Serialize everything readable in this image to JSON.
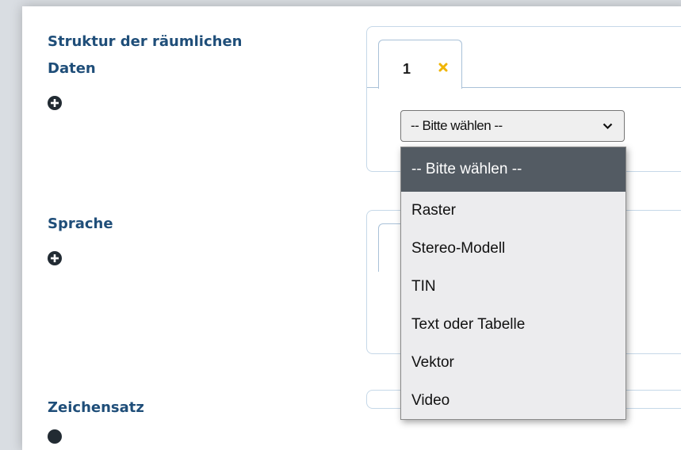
{
  "sections": {
    "structure": {
      "label_line1": "Struktur der räumlichen",
      "label_line2": "Daten"
    },
    "language": {
      "label": "Sprache"
    },
    "charset": {
      "label": "Zeichensatz"
    }
  },
  "tab": {
    "number": "1"
  },
  "select": {
    "value": "-- Bitte wählen --",
    "options": [
      "-- Bitte wählen --",
      "Raster",
      "Stereo-Modell",
      "TIN",
      "Text oder Tabelle",
      "Vektor",
      "Video"
    ],
    "selected_index": 0
  },
  "colors": {
    "label": "#1f4e79",
    "close_x": "#f0b400",
    "highlight": "#535b63"
  },
  "icons": {
    "add": "plus-circle-icon",
    "close": "close-icon",
    "chevron": "chevron-down-icon"
  }
}
